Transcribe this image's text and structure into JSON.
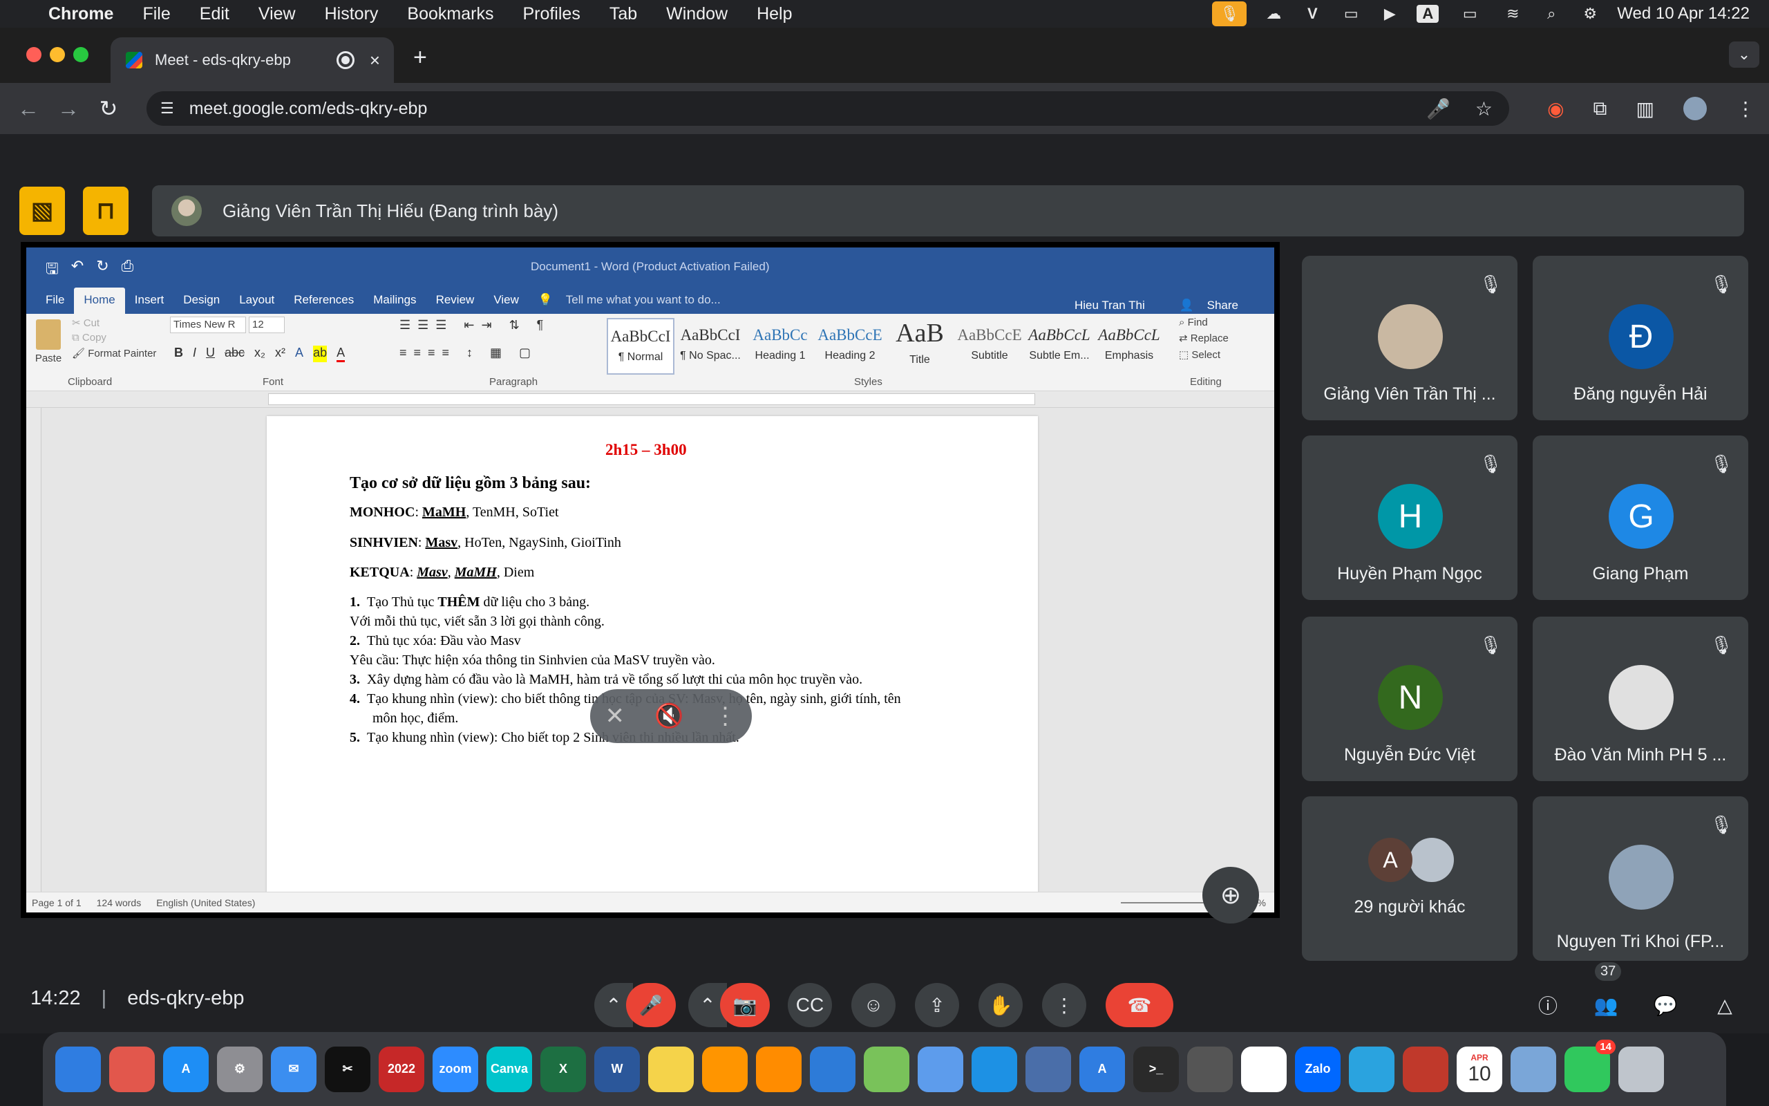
{
  "menubar": {
    "app": "Chrome",
    "items": [
      "File",
      "Edit",
      "View",
      "History",
      "Bookmarks",
      "Profiles",
      "Tab",
      "Window",
      "Help"
    ],
    "clock": "Wed 10 Apr  14:22"
  },
  "browser": {
    "tab_title": "Meet - eds-qkry-ebp",
    "url": "meet.google.com/eds-qkry-ebp"
  },
  "meet": {
    "presenter_text": "Giảng Viên Trần Thị Hiếu (Đang trình bày)",
    "time": "14:22",
    "meeting_code": "eds-qkry-ebp",
    "participant_count": "37",
    "tiles": [
      {
        "name": "Giảng Viên Trần Thị ...",
        "initial": "",
        "color": "#c9b8a2"
      },
      {
        "name": "Đăng nguyễn Hải",
        "initial": "Đ",
        "color": "#0b57a5"
      },
      {
        "name": "Huyền Phạm Ngọc",
        "initial": "H",
        "color": "#0097a7"
      },
      {
        "name": "Giang Phạm",
        "initial": "G",
        "color": "#1e88e5"
      },
      {
        "name": "Nguyễn Đức Việt",
        "initial": "N",
        "color": "#33691e"
      },
      {
        "name": "Đào Văn Minh PH 5 ...",
        "initial": "",
        "color": "#e0e0e0"
      },
      {
        "name": "29 người khác",
        "initial": "A",
        "color": "#5d4037"
      },
      {
        "name": "Nguyen Tri Khoi (FP...",
        "initial": "",
        "color": "#8fa3b8"
      }
    ]
  },
  "word": {
    "title": "Document1 - Word (Product Activation Failed)",
    "tabs": [
      "File",
      "Home",
      "Insert",
      "Design",
      "Layout",
      "References",
      "Mailings",
      "Review",
      "View"
    ],
    "tell_me": "Tell me what you want to do...",
    "user": "Hieu Tran Thi",
    "share": "Share",
    "clipboard": {
      "paste": "Paste",
      "cut": "Cut",
      "copy": "Copy",
      "format_painter": "Format Painter",
      "label": "Clipboard"
    },
    "font": {
      "name": "Times New R",
      "size": "12",
      "label": "Font"
    },
    "paragraph_label": "Paragraph",
    "styles_label": "Styles",
    "editing": {
      "find": "Find",
      "replace": "Replace",
      "select": "Select",
      "label": "Editing"
    },
    "styles": [
      {
        "sample": "AaBbCcI",
        "name": "¶ Normal"
      },
      {
        "sample": "AaBbCcI",
        "name": "¶ No Spac..."
      },
      {
        "sample": "AaBbCc",
        "name": "Heading 1"
      },
      {
        "sample": "AaBbCcE",
        "name": "Heading 2"
      },
      {
        "sample": "AaB",
        "name": "Title"
      },
      {
        "sample": "AaBbCcE",
        "name": "Subtitle"
      },
      {
        "sample": "AaBbCcL",
        "name": "Subtle Em..."
      },
      {
        "sample": "AaBbCcL",
        "name": "Emphasis"
      }
    ],
    "status": {
      "page": "Page 1 of 1",
      "words": "124 words",
      "lang": "English (United States)",
      "zoom": "100%"
    },
    "document": {
      "time": "2h15 – 3h00",
      "heading": "Tạo cơ sở dữ liệu gồm 3 bảng sau:",
      "monhoc_label": "MONHOC",
      "monhoc_key": "MaMH",
      "monhoc_rest": ", TenMH, SoTiet",
      "sinhvien_label": "SINHVIEN",
      "sinhvien_key": "Masv",
      "sinhvien_rest": ", HoTen, NgaySinh, GioiTinh",
      "ketqua_label": "KETQUA",
      "ketqua_key1": "Masv",
      "ketqua_key2": "MaMH",
      "ketqua_rest": ", Diem",
      "item1_num": "1.",
      "item1_a": "Tạo Thủ tục ",
      "item1_b": "THÊM",
      "item1_c": " dữ liệu cho 3 bảng.",
      "note1": "Với mỗi thủ tục, viết sẵn 3 lời gọi thành công.",
      "item2_num": "2.",
      "item2": "Thủ tục xóa: Đầu vào Masv",
      "note2": "Yêu cầu: Thực hiện xóa thông tin Sinhvien của MaSV truyền vào.",
      "item3_num": "3.",
      "item3": "Xây dựng hàm có đầu vào là MaMH, hàm trả về tổng số lượt thi của môn học truyền vào.",
      "item4_num": "4.",
      "item4a": "Tạo khung nhìn (view): cho biết thông tin học tập của SV: Masv, họ tên, ngày sinh, giới tính, tên",
      "item4b": "môn học, điểm.",
      "item5_num": "5.",
      "item5": "Tạo khung nhìn (view): Cho biết top 2 Sinh viên thi nhiều lần nhất."
    }
  },
  "dock": {
    "apps": [
      {
        "label": "",
        "color": "#2f7de1"
      },
      {
        "label": "",
        "color": "#e2574c"
      },
      {
        "label": "A",
        "color": "#1e8ef5"
      },
      {
        "label": "⚙",
        "color": "#8e8e93"
      },
      {
        "label": "✉",
        "color": "#3b8ef0"
      },
      {
        "label": "✂",
        "color": "#111"
      },
      {
        "label": "2022",
        "color": "#c62828"
      },
      {
        "label": "zoom",
        "color": "#2d8cff"
      },
      {
        "label": "Canva",
        "color": "#00c4cc"
      },
      {
        "label": "X",
        "color": "#1d6f42"
      },
      {
        "label": "W",
        "color": "#2b579a"
      },
      {
        "label": "",
        "color": "#f5d34a"
      },
      {
        "label": "",
        "color": "#ff9500"
      },
      {
        "label": "",
        "color": "#ff8c00"
      },
      {
        "label": "",
        "color": "#2d7bd8"
      },
      {
        "label": "",
        "color": "#79c25a"
      },
      {
        "label": "",
        "color": "#5d9cec"
      },
      {
        "label": "",
        "color": "#1d91e4"
      },
      {
        "label": "",
        "color": "#4a6ea9"
      },
      {
        "label": "A",
        "color": "#2f7de1"
      },
      {
        "label": ">_",
        "color": "#2a2a2a"
      },
      {
        "label": "",
        "color": "#555"
      },
      {
        "label": "",
        "color": "#ffffff"
      },
      {
        "label": "Zalo",
        "color": "#0068ff"
      },
      {
        "label": "",
        "color": "#2aa3df"
      },
      {
        "label": "",
        "color": "#c0392b"
      },
      {
        "label": "10",
        "color": "#ffffff"
      },
      {
        "label": "",
        "color": "#7aa6d8"
      },
      {
        "label": "",
        "color": "#30c85d"
      },
      {
        "label": "",
        "color": "#bfc5cc"
      }
    ],
    "calendar_month": "APR",
    "facetime_badge": "14"
  }
}
